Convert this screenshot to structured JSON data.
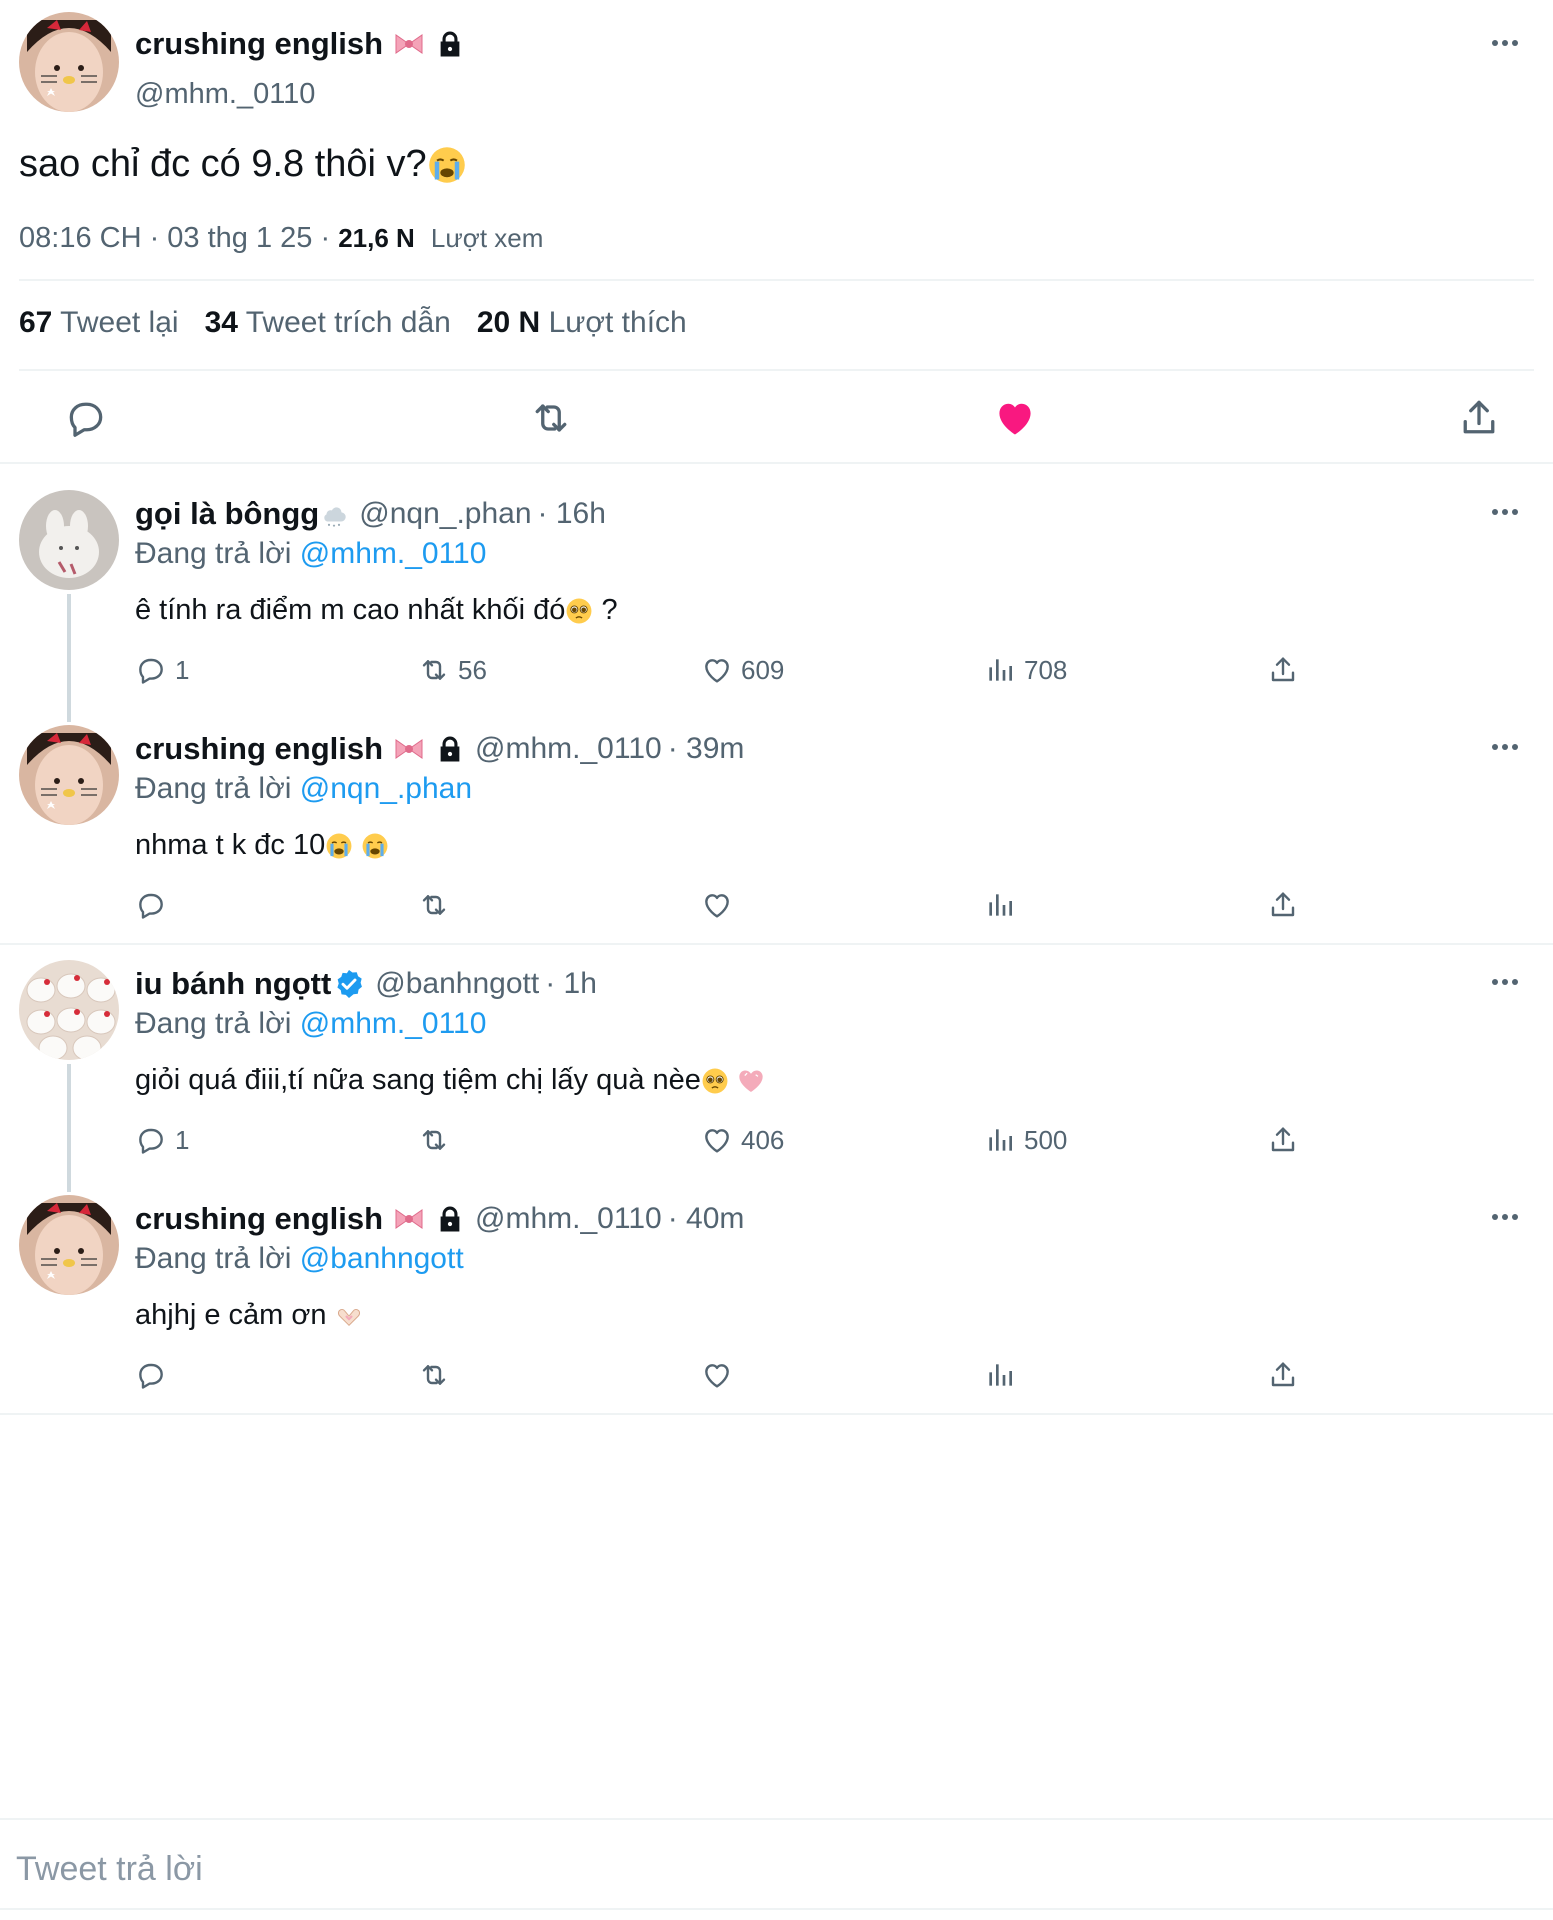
{
  "main_tweet": {
    "display_name": "crushing english",
    "handle": "@mhm._0110",
    "text": "sao chỉ đc có 9.8 thôi v?",
    "time": "08:16 CH · 03 thg 1 25 · ",
    "views_count": "21,6 N",
    "views_label": "Lượt xem",
    "stats": {
      "retweets_count": "67",
      "retweets_label": "Tweet lại",
      "quotes_count": "34",
      "quotes_label": "Tweet trích dẫn",
      "likes_count": "20 N",
      "likes_label": "Lượt thích"
    },
    "liked": true,
    "accent_like": "#f91880"
  },
  "replies": [
    {
      "display_name": "gọi là bôngg",
      "handle": "@nqn_.phan",
      "time": "· 16h",
      "replying_label": "Đang trả lời",
      "replying_to": "@mhm._0110",
      "text": "ê tính ra điểm m cao nhất khối đó",
      "text_suffix": " ?",
      "reply_count": "1",
      "retweet_count": "56",
      "like_count": "609",
      "view_count": "708"
    },
    {
      "display_name": "crushing english",
      "handle": "@mhm._0110",
      "time": "· 39m",
      "replying_label": "Đang trả lời",
      "replying_to": "@nqn_.phan",
      "text": "nhma t k đc 10",
      "reply_count": "",
      "retweet_count": "",
      "like_count": "",
      "view_count": ""
    },
    {
      "display_name": "iu bánh ngọtt",
      "handle": "@banhngott",
      "time": "· 1h",
      "replying_label": "Đang trả lời",
      "replying_to": "@mhm._0110",
      "text": "giỏi quá điii,tí nữa sang tiệm chị lấy quà nèe",
      "reply_count": "1",
      "retweet_count": "",
      "like_count": "406",
      "view_count": "500",
      "verified": true
    },
    {
      "display_name": "crushing english",
      "handle": "@mhm._0110",
      "time": "· 40m",
      "replying_label": "Đang trả lời",
      "replying_to": "@banhngott",
      "text": "ahjhj e cảm ơn",
      "reply_count": "",
      "retweet_count": "",
      "like_count": "",
      "view_count": ""
    }
  ],
  "compose": {
    "placeholder": "Tweet trả lời"
  },
  "colors": {
    "text": "#0f1419",
    "muted": "#536471",
    "link": "#1d9bf0",
    "like": "#f91880",
    "verified": "#1d9bf0",
    "divider": "#eff3f4"
  },
  "icons": [
    "reply-icon",
    "retweet-icon",
    "like-icon",
    "views-icon",
    "share-icon",
    "more-icon",
    "lock-icon",
    "bow-icon",
    "verified-icon",
    "snow-cloud-icon",
    "crying-emoji",
    "pleading-emoji",
    "pink-heart-emoji",
    "heart-hands-emoji"
  ]
}
